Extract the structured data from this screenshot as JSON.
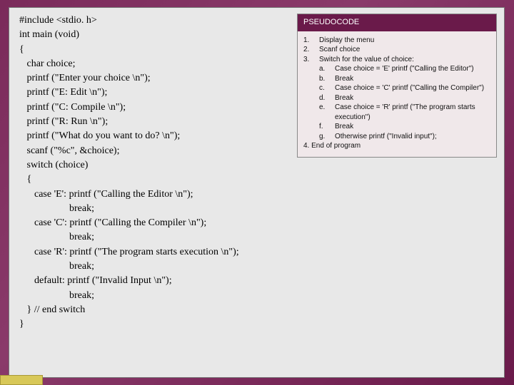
{
  "code": {
    "lines": [
      "#include <stdio. h>",
      "int main (void)",
      "{",
      "   char choice;",
      "   printf (\"Enter your choice \\n\");",
      "   printf (\"E: Edit \\n\");",
      "   printf (\"C: Compile \\n\");",
      "   printf (\"R: Run \\n\");",
      "   printf (\"What do you want to do? \\n\");",
      "",
      "   scanf (\"%c\", &choice);",
      "",
      "   switch (choice)",
      "   {",
      "      case 'E': printf (\"Calling the Editor \\n\");",
      "                    break;",
      "      case 'C': printf (\"Calling the Compiler \\n\");",
      "                    break;",
      "      case 'R': printf (\"The program starts execution \\n\");",
      "                    break;",
      "      default: printf (\"Invalid Input \\n\");",
      "                    break;",
      "   } // end switch",
      "}"
    ]
  },
  "pseudo": {
    "header": "PSEUDOCODE",
    "items": [
      {
        "num": "1.",
        "text": "Display the menu"
      },
      {
        "num": "2.",
        "text": "Scanf choice"
      },
      {
        "num": "3.",
        "text": "Switch for the value of choice:"
      }
    ],
    "subs": [
      {
        "letter": "a.",
        "text": "Case choice = 'E' printf (\"Calling the Editor\")"
      },
      {
        "letter": "b.",
        "text": "Break"
      },
      {
        "letter": "c.",
        "text": "Case choice = 'C' printf (\"Calling the Compiler\")"
      },
      {
        "letter": "d.",
        "text": "Break"
      },
      {
        "letter": "e.",
        "text": "Case choice = 'R' printf (\"The program starts execution\")"
      },
      {
        "letter": "f.",
        "text": "Break"
      },
      {
        "letter": "g.",
        "text": "Otherwise printf (\"Invalid input\");"
      }
    ],
    "final": "4. End of program"
  }
}
